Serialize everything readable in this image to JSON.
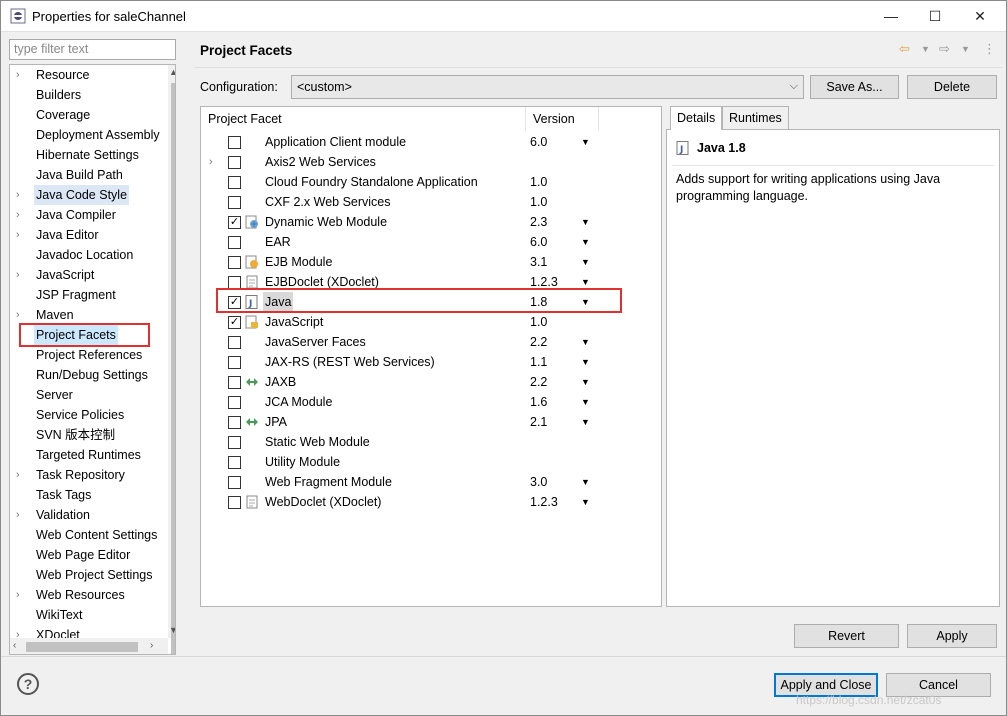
{
  "window": {
    "title": "Properties for saleChannel",
    "minimize": "—",
    "maximize": "☐",
    "close": "✕"
  },
  "filter": {
    "placeholder": "type filter text"
  },
  "tree": {
    "items": [
      {
        "label": "Resource",
        "arrow": "›"
      },
      {
        "label": "Builders",
        "arrow": ""
      },
      {
        "label": "Coverage",
        "arrow": ""
      },
      {
        "label": "Deployment Assembly",
        "arrow": ""
      },
      {
        "label": "Hibernate Settings",
        "arrow": ""
      },
      {
        "label": "Java Build Path",
        "arrow": ""
      },
      {
        "label": "Java Code Style",
        "arrow": "›",
        "state": "hl"
      },
      {
        "label": "Java Compiler",
        "arrow": "›"
      },
      {
        "label": "Java Editor",
        "arrow": "›"
      },
      {
        "label": "Javadoc Location",
        "arrow": ""
      },
      {
        "label": "JavaScript",
        "arrow": "›"
      },
      {
        "label": "JSP Fragment",
        "arrow": ""
      },
      {
        "label": "Maven",
        "arrow": "›"
      },
      {
        "label": "Project Facets",
        "arrow": "",
        "state": "sel"
      },
      {
        "label": "Project References",
        "arrow": ""
      },
      {
        "label": "Run/Debug Settings",
        "arrow": ""
      },
      {
        "label": "Server",
        "arrow": ""
      },
      {
        "label": "Service Policies",
        "arrow": ""
      },
      {
        "label": "SVN 版本控制",
        "arrow": ""
      },
      {
        "label": "Targeted Runtimes",
        "arrow": ""
      },
      {
        "label": "Task Repository",
        "arrow": "›"
      },
      {
        "label": "Task Tags",
        "arrow": ""
      },
      {
        "label": "Validation",
        "arrow": "›"
      },
      {
        "label": "Web Content Settings",
        "arrow": ""
      },
      {
        "label": "Web Page Editor",
        "arrow": ""
      },
      {
        "label": "Web Project Settings",
        "arrow": ""
      },
      {
        "label": "Web Resources",
        "arrow": "›"
      },
      {
        "label": "WikiText",
        "arrow": ""
      },
      {
        "label": "XDoclet",
        "arrow": "›"
      }
    ]
  },
  "page": {
    "title": "Project Facets"
  },
  "config": {
    "label": "Configuration:",
    "value": "<custom>",
    "save_as": "Save As...",
    "delete": "Delete"
  },
  "table": {
    "col_facet": "Project Facet",
    "col_version": "Version",
    "rows": [
      {
        "name": "Application Client module",
        "version": "6.0",
        "checked": false,
        "expand": "",
        "dd": true,
        "icon": "none"
      },
      {
        "name": "Axis2 Web Services",
        "version": "",
        "checked": false,
        "expand": "›",
        "dd": false,
        "icon": "none"
      },
      {
        "name": "Cloud Foundry Standalone Application",
        "version": "1.0",
        "checked": false,
        "expand": "",
        "dd": false,
        "icon": "none"
      },
      {
        "name": "CXF 2.x Web Services",
        "version": "1.0",
        "checked": false,
        "expand": "",
        "dd": false,
        "icon": "none"
      },
      {
        "name": "Dynamic Web Module",
        "version": "2.3",
        "checked": true,
        "expand": "",
        "dd": true,
        "icon": "web"
      },
      {
        "name": "EAR",
        "version": "6.0",
        "checked": false,
        "expand": "",
        "dd": true,
        "icon": "none"
      },
      {
        "name": "EJB Module",
        "version": "3.1",
        "checked": false,
        "expand": "",
        "dd": true,
        "icon": "ejb"
      },
      {
        "name": "EJBDoclet (XDoclet)",
        "version": "1.2.3",
        "checked": false,
        "expand": "",
        "dd": true,
        "icon": "page"
      },
      {
        "name": "Java",
        "version": "1.8",
        "checked": true,
        "expand": "",
        "dd": true,
        "icon": "java",
        "selected": true
      },
      {
        "name": "JavaScript",
        "version": "1.0",
        "checked": true,
        "expand": "",
        "dd": false,
        "icon": "js"
      },
      {
        "name": "JavaServer Faces",
        "version": "2.2",
        "checked": false,
        "expand": "",
        "dd": true,
        "icon": "none"
      },
      {
        "name": "JAX-RS (REST Web Services)",
        "version": "1.1",
        "checked": false,
        "expand": "",
        "dd": true,
        "icon": "none"
      },
      {
        "name": "JAXB",
        "version": "2.2",
        "checked": false,
        "expand": "",
        "dd": true,
        "icon": "jaxb"
      },
      {
        "name": "JCA Module",
        "version": "1.6",
        "checked": false,
        "expand": "",
        "dd": true,
        "icon": "none"
      },
      {
        "name": "JPA",
        "version": "2.1",
        "checked": false,
        "expand": "",
        "dd": true,
        "icon": "jaxb"
      },
      {
        "name": "Static Web Module",
        "version": "",
        "checked": false,
        "expand": "",
        "dd": false,
        "icon": "none"
      },
      {
        "name": "Utility Module",
        "version": "",
        "checked": false,
        "expand": "",
        "dd": false,
        "icon": "none"
      },
      {
        "name": "Web Fragment Module",
        "version": "3.0",
        "checked": false,
        "expand": "",
        "dd": true,
        "icon": "none"
      },
      {
        "name": "WebDoclet (XDoclet)",
        "version": "1.2.3",
        "checked": false,
        "expand": "",
        "dd": true,
        "icon": "page"
      }
    ]
  },
  "details": {
    "tab_details": "Details",
    "tab_runtimes": "Runtimes",
    "title": "Java 1.8",
    "description": "Adds support for writing applications using Java programming language."
  },
  "buttons": {
    "revert": "Revert",
    "apply": "Apply",
    "apply_close": "Apply and Close",
    "cancel": "Cancel"
  },
  "help": "?",
  "watermark": "https://blog.csdn.net/zcat0s",
  "colors": {
    "annotation": "#e03030",
    "selection": "#cce8ff",
    "default_button_border": "#0078d7"
  }
}
